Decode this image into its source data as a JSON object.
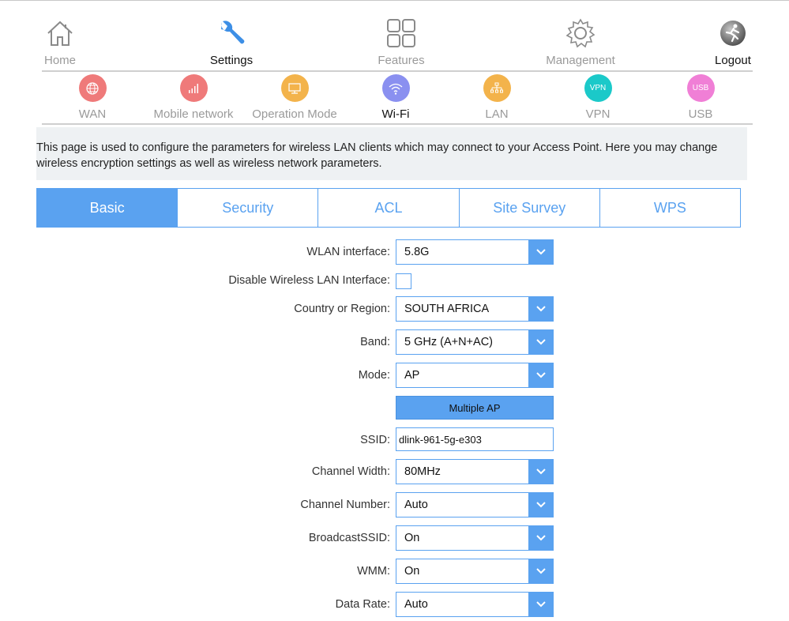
{
  "top_nav": {
    "items": [
      {
        "label": "Home",
        "icon": "home-icon"
      },
      {
        "label": "Settings",
        "icon": "wrench-icon"
      },
      {
        "label": "Features",
        "icon": "grid-icon"
      },
      {
        "label": "Management",
        "icon": "gear-icon"
      },
      {
        "label": "Logout",
        "icon": "logout-icon"
      }
    ],
    "active": "Settings"
  },
  "sub_nav": {
    "items": [
      {
        "label": "WAN",
        "icon": "globe-icon",
        "color": "#ef7a7a"
      },
      {
        "label": "Mobile network",
        "icon": "signal-bars-icon",
        "color": "#ef7a7a"
      },
      {
        "label": "Operation Mode",
        "icon": "monitor-icon",
        "color": "#f3b34b"
      },
      {
        "label": "Wi-Fi",
        "icon": "wifi-icon",
        "color": "#8a90f0"
      },
      {
        "label": "LAN",
        "icon": "network-tree-icon",
        "color": "#f3b34b"
      },
      {
        "label": "VPN",
        "icon": "vpn-icon",
        "badge": "VPN",
        "color": "#1bc9c9"
      },
      {
        "label": "USB",
        "icon": "usb-icon",
        "badge": "USB",
        "color": "#f07fd6"
      }
    ],
    "active": "Wi-Fi"
  },
  "info_text": "This page is used to configure the parameters for wireless LAN clients which may connect to your Access Point. Here you may change wireless encryption settings as well as wireless network parameters.",
  "tabs": [
    {
      "label": "Basic",
      "active": true
    },
    {
      "label": "Security",
      "active": false
    },
    {
      "label": "ACL",
      "active": false
    },
    {
      "label": "Site Survey",
      "active": false
    },
    {
      "label": "WPS",
      "active": false
    }
  ],
  "form": {
    "wlan_interface": {
      "label": "WLAN interface:",
      "value": "5.8G"
    },
    "disable_wlan": {
      "label": "Disable Wireless LAN Interface:",
      "checked": false
    },
    "country": {
      "label": "Country or Region:",
      "value": "SOUTH AFRICA"
    },
    "band": {
      "label": "Band:",
      "value": "5 GHz (A+N+AC)"
    },
    "mode": {
      "label": "Mode:",
      "value": "AP"
    },
    "multiple_ap_button": "Multiple AP",
    "ssid": {
      "label": "SSID:",
      "value": "dlink-961-5g-e303"
    },
    "channel_width": {
      "label": "Channel Width:",
      "value": "80MHz"
    },
    "channel_number": {
      "label": "Channel Number:",
      "value": "Auto"
    },
    "broadcast_ssid": {
      "label": "BroadcastSSID:",
      "value": "On"
    },
    "wmm": {
      "label": "WMM:",
      "value": "On"
    },
    "data_rate": {
      "label": "Data Rate:",
      "value": "Auto"
    }
  },
  "colors": {
    "accent": "#5aa2f0",
    "info_bg": "#eef1f3"
  }
}
